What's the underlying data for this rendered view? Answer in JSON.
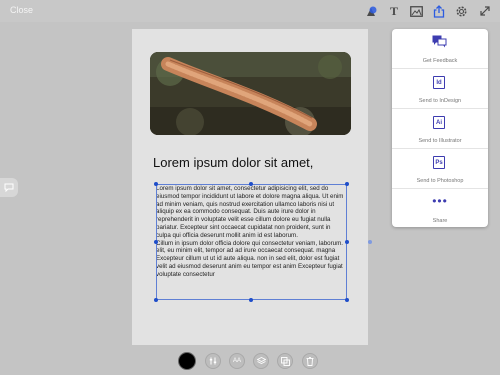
{
  "topbar": {
    "close_label": "Close",
    "icons": [
      "shapes-icon",
      "text-icon",
      "image-icon",
      "share-icon",
      "settings-icon",
      "expand-icon"
    ],
    "text_tool_glyph": "T"
  },
  "document": {
    "heading": "Lorem ipsum dolor sit amet,",
    "paragraph1": "Lorem ipsum dolor sit amet, consectetur adipisicing elit, sed do eiusmod tempor incididunt ut labore et dolore magna aliqua. Ut enim ad minim veniam, quis nostrud exercitation ullamco laboris nisi ut aliquip ex ea commodo consequat. Duis aute irure dolor in reprehenderit in voluptate velit esse cillum dolore eu fugiat nulla pariatur. Excepteur sint occaecat cupidatat non proident, sunt in culpa qui officia deserunt mollit anim id est laborum.",
    "paragraph2": "Cillum in ipsum dolor officia dolore qui consectetur veniam, laborum. elit, eu minim elit, tempor ad ad irure occaecat consequat. magna Excepteur cillum ut ut id aute aliqua. non in sed elit, dolor est fugiat velit ad eiusmod deserunt anim eu tempor est anim Excepteur fugiat voluptate consectetur"
  },
  "share_menu": {
    "items": [
      {
        "label": "Get Feedback",
        "icon": "feedback-icon"
      },
      {
        "label": "Send to InDesign",
        "icon_text": "Id"
      },
      {
        "label": "Send to Illustrator",
        "icon_text": "Ai"
      },
      {
        "label": "Send to Photoshop",
        "icon_text": "Ps"
      },
      {
        "label": "Share",
        "icon_text": "•••"
      }
    ]
  },
  "bottom_toolbar": {
    "selected_color": "#000000",
    "font_button_text": "AA",
    "buttons": [
      "color-swatch",
      "adjust-icon",
      "font-size-icon",
      "layers-icon",
      "duplicate-icon",
      "trash-icon"
    ]
  },
  "colors": {
    "accent": "#3d3cb0",
    "selection": "#1f4ec9",
    "background": "#c4c4c4"
  }
}
